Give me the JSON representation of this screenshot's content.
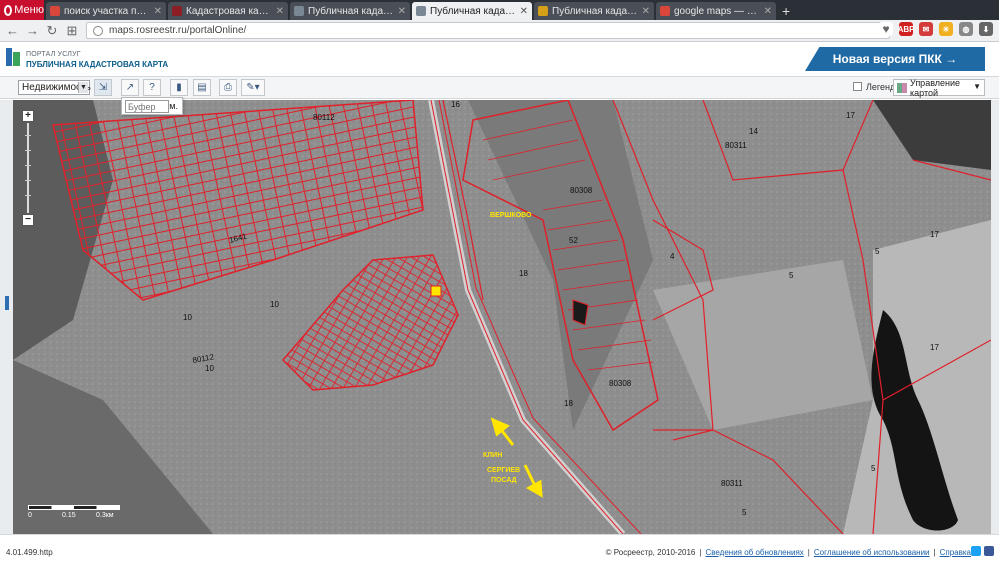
{
  "browser": {
    "menu_label": "Меню",
    "tabs": [
      {
        "title": "поиск участка по кадаст",
        "favicon_color": "#d9463a"
      },
      {
        "title": "Кадастровая карта Моск",
        "favicon_color": "#8b1e24"
      },
      {
        "title": "Публичная кадастровая",
        "favicon_color": "#7a8896"
      },
      {
        "title": "Публичная кадастровая к",
        "favicon_color": "#7a8896",
        "active": true
      },
      {
        "title": "Публичная кадастровая",
        "favicon_color": "#d4a017"
      },
      {
        "title": "google maps — Яндекс:",
        "favicon_color": "#d9463a"
      }
    ],
    "new_tab_label": "+",
    "url": "maps.rosreestr.ru/portalOnline/",
    "extensions": [
      "heart-icon",
      "adblock-icon",
      "mail-icon",
      "weather-icon",
      "globe-icon",
      "download-icon"
    ]
  },
  "portal": {
    "subtitle": "ПОРТАЛ УСЛУГ",
    "title": "ПУБЛИЧНАЯ КАДАСТРОВАЯ КАРТА",
    "new_version_label": "Новая версия ПКК →",
    "new_version_color": "#1f6aa5"
  },
  "toolbar": {
    "layer_select": "Недвижимость",
    "legend_label": "Легенда",
    "map_manager_label": "Управление картой",
    "buttons": [
      "select-tool-icon",
      "identify-tool-icon",
      "info-tool-icon",
      "chart-tool-icon",
      "layers-tool-icon",
      "print-tool-icon",
      "measure-tool-icon"
    ]
  },
  "buffer": {
    "placeholder": "Буфер",
    "unit": "м."
  },
  "map": {
    "parcel_color": "#e0202a",
    "labels": [
      {
        "text": "16",
        "id": "l16"
      },
      {
        "text": "80112",
        "id": "l80112a"
      },
      {
        "text": "1641",
        "id": "l1641"
      },
      {
        "text": "10",
        "id": "l10a"
      },
      {
        "text": "10",
        "id": "l10b"
      },
      {
        "text": "80112",
        "id": "l80112b"
      },
      {
        "text": "10",
        "id": "l10c"
      },
      {
        "text": "80308",
        "id": "l80308a"
      },
      {
        "text": "52",
        "id": "l52"
      },
      {
        "text": "18",
        "id": "l18a"
      },
      {
        "text": "4",
        "id": "l4"
      },
      {
        "text": "80308",
        "id": "l80308b"
      },
      {
        "text": "18",
        "id": "l18b"
      },
      {
        "text": "80311",
        "id": "l80311a"
      },
      {
        "text": "14",
        "id": "l14"
      },
      {
        "text": "17",
        "id": "l17a"
      },
      {
        "text": "17",
        "id": "l17b"
      },
      {
        "text": "5",
        "id": "l5a"
      },
      {
        "text": "5",
        "id": "l5b"
      },
      {
        "text": "17",
        "id": "l17c"
      },
      {
        "text": "80311",
        "id": "l80311b"
      },
      {
        "text": "5",
        "id": "l5c"
      },
      {
        "text": "5",
        "id": "l5d"
      }
    ],
    "annotations": {
      "village": "ВЕРШКОВО",
      "to_klin": "КЛИН",
      "to_sergiev_1": "СЕРГИЕВ",
      "to_sergiev_2": "ПОСАД"
    },
    "annotation_color": "#ffe600",
    "scale": {
      "s0": "0",
      "s1": "0.15",
      "s2": "0.3км"
    }
  },
  "status": {
    "version": "4.01.499.http",
    "copyright": "© Росреестр, 2010-2016",
    "links": [
      "Сведения об обновлениях",
      "Соглашение об использовании",
      "Справка"
    ]
  }
}
